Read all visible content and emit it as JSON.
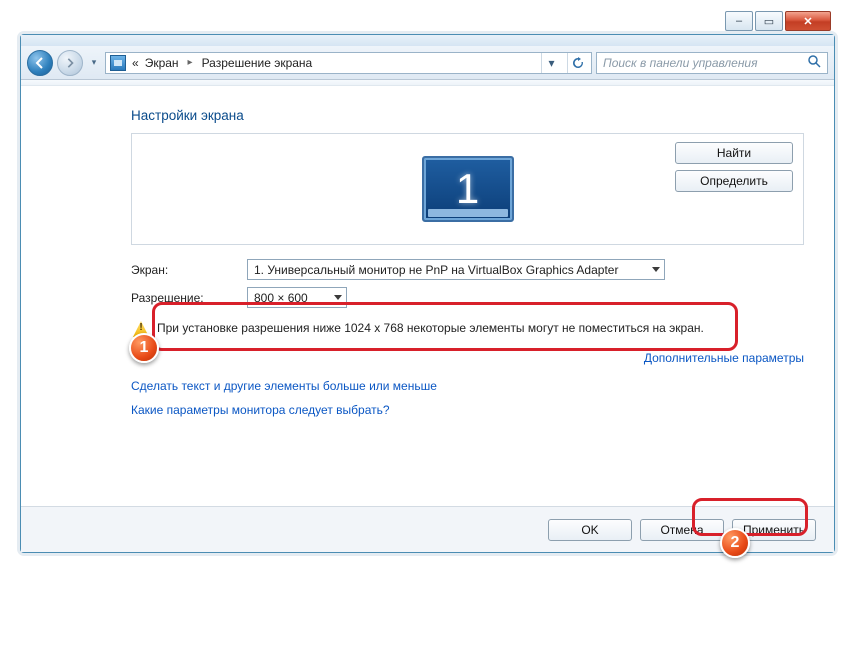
{
  "window_controls": {
    "min": "–",
    "max": "▭",
    "close": "✕"
  },
  "breadcrumb": {
    "prefix": "«",
    "seg1": "Экран",
    "seg2": "Разрешение экрана"
  },
  "search": {
    "placeholder": "Поиск в панели управления"
  },
  "page_title": "Настройки экрана",
  "preview": {
    "find": "Найти",
    "detect": "Определить",
    "monitor_num": "1"
  },
  "form": {
    "screen_label": "Экран:",
    "screen_value": "1. Универсальный монитор не PnP на VirtualBox Graphics Adapter",
    "resolution_label": "Разрешение:",
    "resolution_value": "800 × 600"
  },
  "warning": "При установке разрешения ниже 1024 х 768 некоторые элементы могут не поместиться на экран.",
  "links": {
    "advanced": "Дополнительные параметры",
    "text_size": "Сделать текст и другие элементы больше или меньше",
    "which_monitor": "Какие параметры монитора следует выбрать?"
  },
  "buttons": {
    "ok": "OK",
    "cancel": "Отмена",
    "apply": "Применить"
  },
  "callouts": {
    "c1": "1",
    "c2": "2"
  }
}
